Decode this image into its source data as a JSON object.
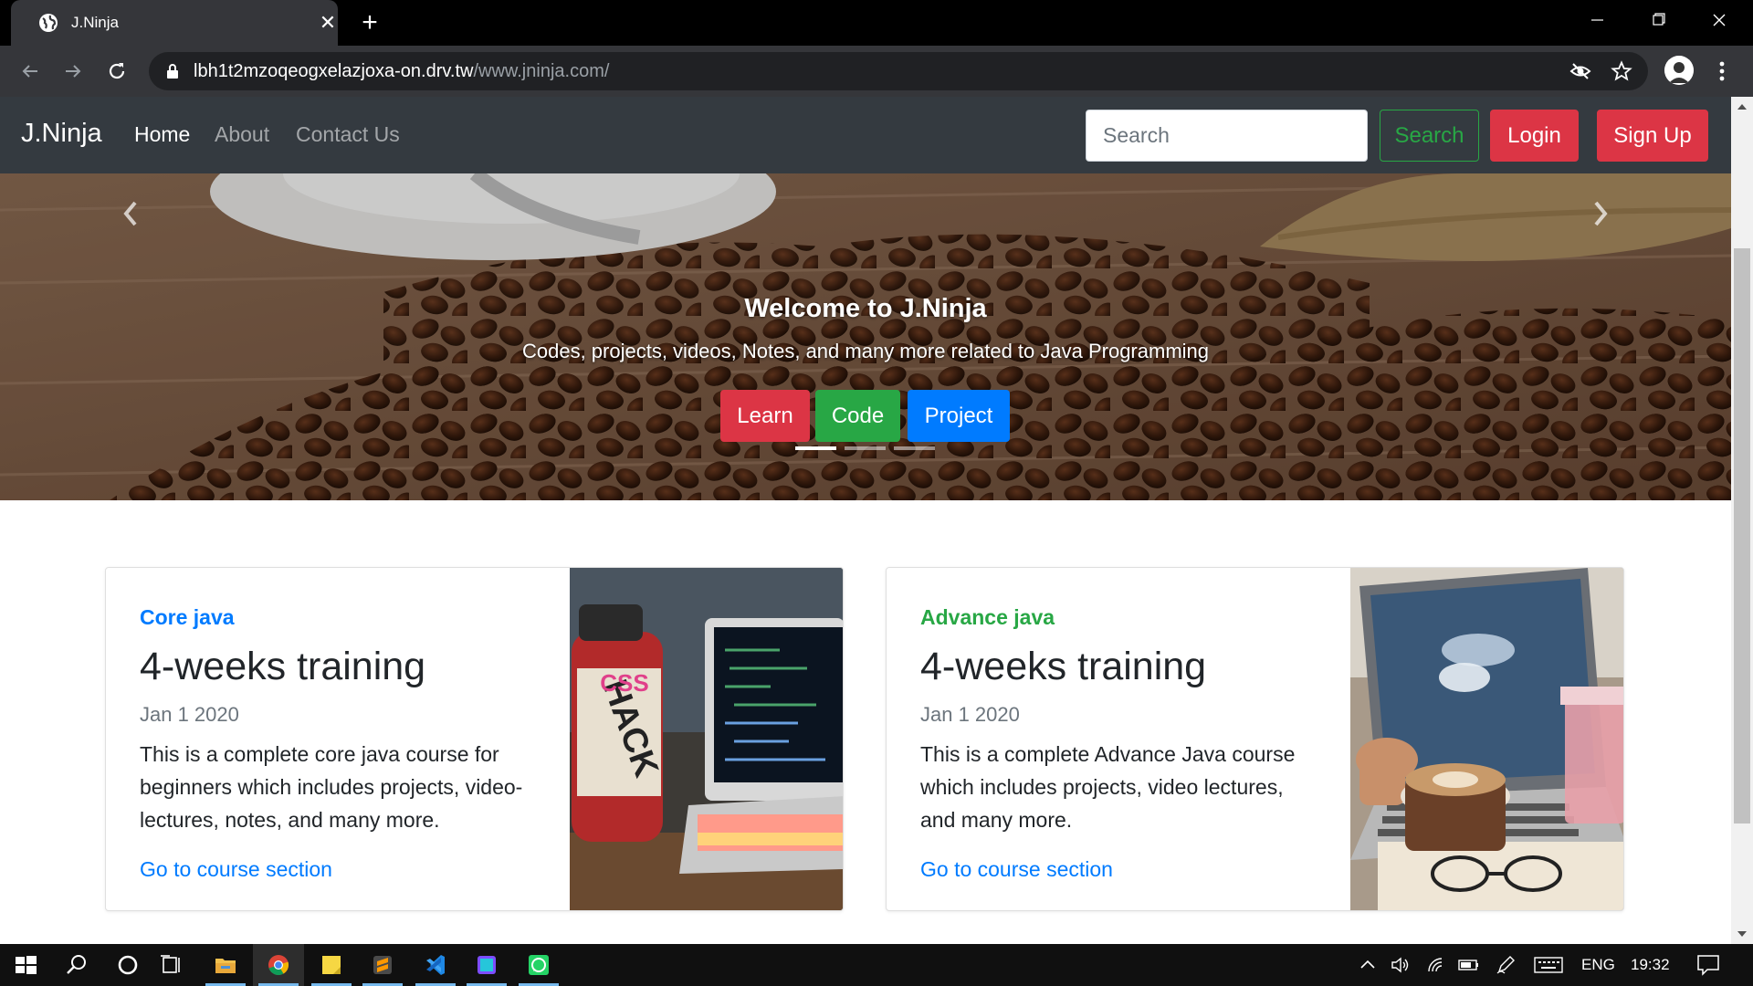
{
  "browser": {
    "tab_title": "J.Ninja",
    "url_host": "lbh1t2mzoqeogxelazjoxa-on.drv.tw",
    "url_path": "/www.jninja.com/"
  },
  "navbar": {
    "brand": "J.Ninja",
    "links": [
      "Home",
      "About",
      "Contact Us"
    ],
    "search_placeholder": "Search",
    "search_button": "Search",
    "login_button": "Login",
    "signup_button": "Sign Up"
  },
  "carousel": {
    "title": "Welcome to J.Ninja",
    "text": "Codes, projects, videos, Notes, and many more related to Java Programming",
    "buttons": [
      "Learn",
      "Code",
      "Project"
    ],
    "active_slide": 1,
    "slide_count": 3
  },
  "cards": [
    {
      "category": "Core java",
      "category_color": "#007bff",
      "title": "4-weeks training",
      "date": "Jan 1 2020",
      "text": "This is a complete core java course for beginners which includes projects, video-lectures, notes, and many more.",
      "link": "Go to course section"
    },
    {
      "category": "Advance java",
      "category_color": "#28a745",
      "title": "4-weeks training",
      "date": "Jan 1 2020",
      "text": "This is a complete Advance Java course which includes projects, video lectures, and many more.",
      "link": "Go to course section"
    }
  ],
  "taskbar": {
    "icons": [
      "windows-start-icon",
      "search-icon",
      "cortana-icon",
      "task-view-icon",
      "file-explorer-icon",
      "chrome-icon",
      "sticky-notes-icon",
      "sublime-text-icon",
      "vscode-icon",
      "app-icon",
      "whatsapp-icon"
    ],
    "language": "ENG",
    "time": "19:32"
  },
  "colors": {
    "navbar_bg": "#343a40",
    "primary": "#007bff",
    "success": "#28a745",
    "danger": "#dc3545"
  }
}
